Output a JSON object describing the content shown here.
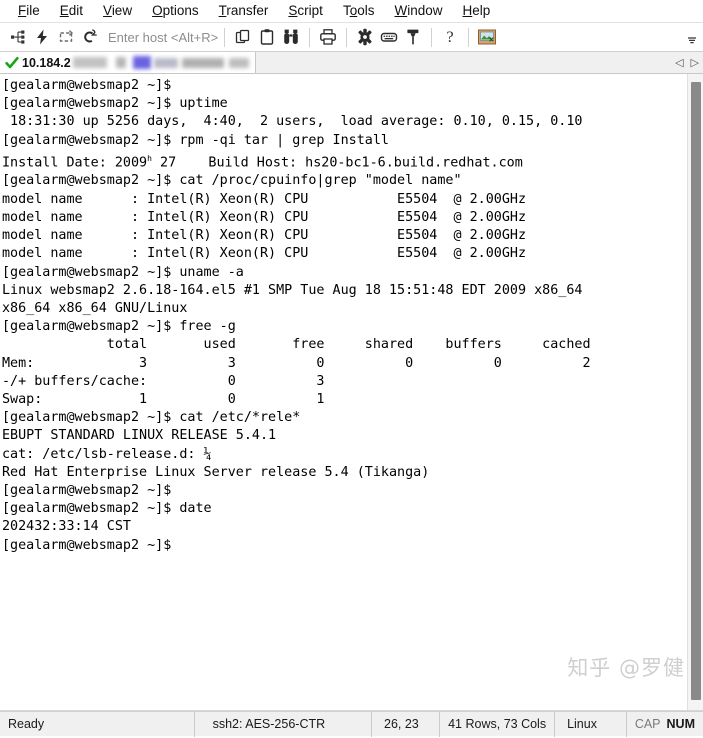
{
  "menu": {
    "items": [
      {
        "label": "File",
        "accel": "F"
      },
      {
        "label": "Edit",
        "accel": "E"
      },
      {
        "label": "View",
        "accel": "V"
      },
      {
        "label": "Options",
        "accel": "O"
      },
      {
        "label": "Transfer",
        "accel": "T"
      },
      {
        "label": "Script",
        "accel": "S"
      },
      {
        "label": "Tools",
        "accel": "T"
      },
      {
        "label": "Window",
        "accel": "W"
      },
      {
        "label": "Help",
        "accel": "H"
      }
    ]
  },
  "toolbar": {
    "host_placeholder": "Enter host <Alt+R>",
    "icons": [
      "connect-icon",
      "quick-connect-icon",
      "reconnect-icon",
      "disconnect-icon",
      "copy-icon",
      "paste-icon",
      "find-icon",
      "print-icon",
      "settings-gear-icon",
      "keyboard-icon",
      "key-icon",
      "help-icon",
      "session-manager-icon",
      "chevron-down-icon"
    ]
  },
  "tab": {
    "label": "10.184.2",
    "status_icon": "green-check-icon",
    "nav_prev": "◁",
    "nav_next": "▷"
  },
  "terminal": {
    "lines": [
      "[gealarm@websmap2 ~]$",
      "[gealarm@websmap2 ~]$ uptime",
      " 18:31:30 up 5256 days,  4:40,  2 users,  load average: 0.10, 0.15, 0.10",
      "[gealarm@websmap2 ~]$ rpm -qi tar | grep Install",
      "Install Date: 2009@27    Build Host: hs20-bc1-6.build.redhat.com",
      "[gealarm@websmap2 ~]$ cat /proc/cpuinfo|grep \"model name\"",
      "model name      : Intel(R) Xeon(R) CPU           E5504  @ 2.00GHz",
      "model name      : Intel(R) Xeon(R) CPU           E5504  @ 2.00GHz",
      "model name      : Intel(R) Xeon(R) CPU           E5504  @ 2.00GHz",
      "model name      : Intel(R) Xeon(R) CPU           E5504  @ 2.00GHz",
      "[gealarm@websmap2 ~]$ uname -a",
      "Linux websmap2 2.6.18-164.el5 #1 SMP Tue Aug 18 15:51:48 EDT 2009 x86_64",
      "x86_64 x86_64 GNU/Linux",
      "[gealarm@websmap2 ~]$ free -g",
      "             total       used       free     shared    buffers     cached",
      "Mem:             3          3          0          0          0          2",
      "-/+ buffers/cache:          0          3",
      "Swap:            1          0          1",
      "[gealarm@websmap2 ~]$ cat /etc/*rele*",
      "EBUPT STANDARD LINUX RELEASE 5.4.1",
      "cat: /etc/lsb-release.d: ¼",
      "Red Hat Enterprise Linux Server release 5.4 (Tikanga)",
      "[gealarm@websmap2 ~]$",
      "[gealarm@websmap2 ~]$ date",
      "202432:33:14 CST",
      "[gealarm@websmap2 ~]$"
    ],
    "install_date_prefix": "Install Date: 2009",
    "install_date_sup": "h",
    "install_date_suffix": " 27    Build Host: hs20-bc1-6.build.redhat.com"
  },
  "watermark": {
    "text": "知乎 @罗健"
  },
  "statusbar": {
    "ready": "Ready",
    "cipher": "ssh2: AES-256-CTR",
    "position": "26, 23",
    "size": "41 Rows, 73 Cols",
    "os": "Linux",
    "caps": "CAP",
    "num": "NUM"
  }
}
